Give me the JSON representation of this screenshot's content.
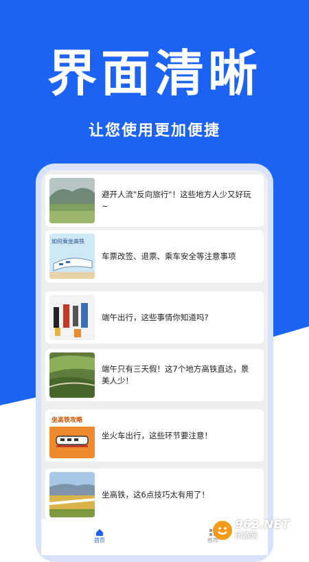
{
  "headline": "界面清晰",
  "subline": "让您使用更加便捷",
  "articles": [
    {
      "title": "避开人流\"反向旅行\"！这些地方人少又好玩~"
    },
    {
      "title": "车票改签、退票、乘车安全等注意事项",
      "thumb_caption": "如何乘坐高铁"
    },
    {
      "title": "端午出行，这些事情你知道吗?"
    },
    {
      "title": "端午只有三天假！这7个地方高铁直达，景美人少！"
    },
    {
      "title": "坐火车出行，这些环节要注意！",
      "thumb_caption": "坐高铁攻略"
    },
    {
      "title": "坐高铁，这6点技巧太有用了！"
    }
  ],
  "tabs": [
    {
      "label": "首页",
      "icon": "home-icon",
      "active": true
    },
    {
      "label": "推荐",
      "icon": "grid-icon",
      "active": false
    }
  ],
  "watermark": {
    "number": "962.NET",
    "sub": "乐游网"
  },
  "colors": {
    "brand_blue": "#1d63f3",
    "text": "#222222",
    "tab_active": "#1d63f3",
    "watermark_orange": "#f29b1d"
  }
}
